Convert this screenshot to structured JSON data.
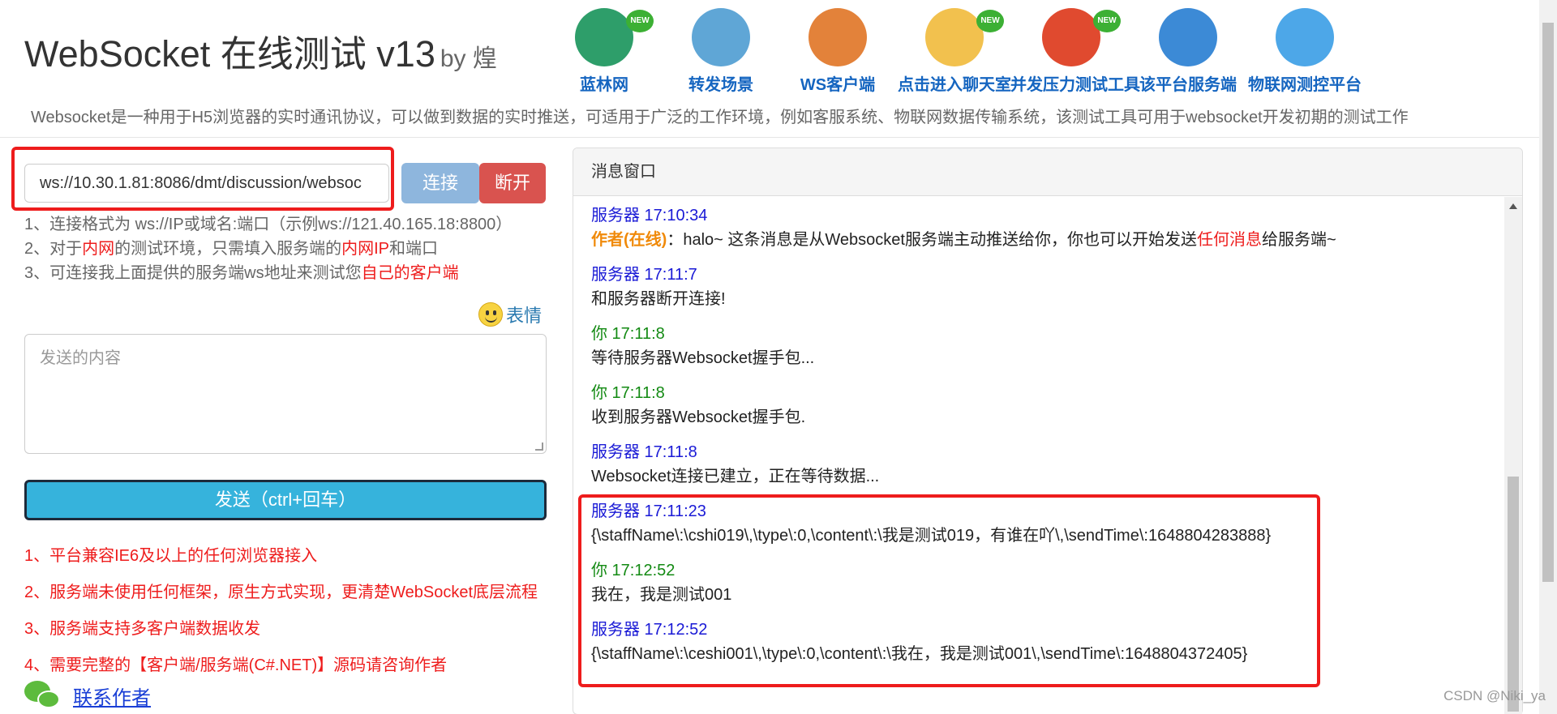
{
  "header": {
    "title": "WebSocket 在线测试 v13",
    "by": "by 煌",
    "description": "Websocket是一种用于H5浏览器的实时通讯协议，可以做到数据的实时推送，可适用于广泛的工作环境，例如客服系统、物联网数据传输系统，该测试工具可用于websocket开发初期的测试工作",
    "nav": [
      {
        "label": "蓝林网",
        "icon": "globe-icon",
        "new": "NEW",
        "color": "#2e9e6a"
      },
      {
        "label": "转发场景",
        "icon": "antenna-icon",
        "new": "",
        "color": "#5fa6d6"
      },
      {
        "label": "WS客户端",
        "icon": "speaker-icon",
        "new": "",
        "color": "#e3823a"
      },
      {
        "label": "点击进入聊天室",
        "icon": "chat-users-icon",
        "new": "NEW",
        "color": "#f2c14e"
      },
      {
        "label": "并发压力测试工具",
        "icon": "pencil-ruler-icon",
        "new": "NEW",
        "color": "#e04a2f"
      },
      {
        "label": "该平台服务端",
        "icon": "earth-icon",
        "new": "",
        "color": "#3c8ad6"
      },
      {
        "label": "物联网测控平台",
        "icon": "cloud-icon",
        "new": "",
        "color": "#4da7e8"
      }
    ]
  },
  "connect": {
    "url": "ws://10.30.1.81:8086/dmt/discussion/websoc",
    "connect_label": "连接",
    "disconnect_label": "断开"
  },
  "tips": {
    "line1": "1、连接格式为 ws://IP或域名:端口（示例ws://121.40.165.18:8800）",
    "line2_a": "2、对于",
    "line2_b": "内网",
    "line2_c": "的测试环境，只需填入服务端的",
    "line2_d": "内网IP",
    "line2_e": "和端口",
    "line3_a": "3、可连接我上面提供的服务端ws地址来测试您",
    "line3_b": "自己的客户端"
  },
  "emoji_label": "表情",
  "compose": {
    "placeholder": "发送的内容",
    "send_label": "发送（ctrl+回车）"
  },
  "features": [
    "1、平台兼容IE6及以上的任何浏览器接入",
    "2、服务端未使用任何框架，原生方式实现，更清楚WebSocket底层流程",
    "3、服务端支持多客户端数据收发",
    "4、需要完整的【客户端/服务端(C#.NET)】源码请咨询作者"
  ],
  "contact_label": "联系作者",
  "panel": {
    "title": "消息窗口",
    "messages": [
      {
        "who": "服务器 17:10:34",
        "kind": "server",
        "text": ""
      },
      {
        "who": "服务器 17:11:7",
        "kind": "server",
        "text": "和服务器断开连接!"
      },
      {
        "who": "你 17:11:8",
        "kind": "you",
        "text": "等待服务器Websocket握手包..."
      },
      {
        "who": "你 17:11:8",
        "kind": "you",
        "text": "收到服务器Websocket握手包."
      },
      {
        "who": "服务器 17:11:8",
        "kind": "server",
        "text": "Websocket连接已建立，正在等待数据..."
      },
      {
        "who": "服务器 17:11:23",
        "kind": "server",
        "text": "{\\staffName\\:\\cshi019\\,\\type\\:0,\\content\\:\\我是测试019，有谁在吖\\,\\sendTime\\:1648804283888}"
      },
      {
        "who": "你 17:12:52",
        "kind": "you",
        "text": "我在，我是测试001"
      },
      {
        "who": "服务器 17:12:52",
        "kind": "server",
        "text": "{\\staffName\\:\\ceshi001\\,\\type\\:0,\\content\\:\\我在，我是测试001\\,\\sendTime\\:1648804372405}"
      }
    ],
    "first_msg": {
      "author": "作者(在线)",
      "part1": "：halo~ 这条消息是从Websocket服务端主动推送给你，你也可以开始发送",
      "highlight": "任何消息",
      "part2": "给服务端~"
    }
  },
  "watermark": "CSDN @Niki_ya"
}
